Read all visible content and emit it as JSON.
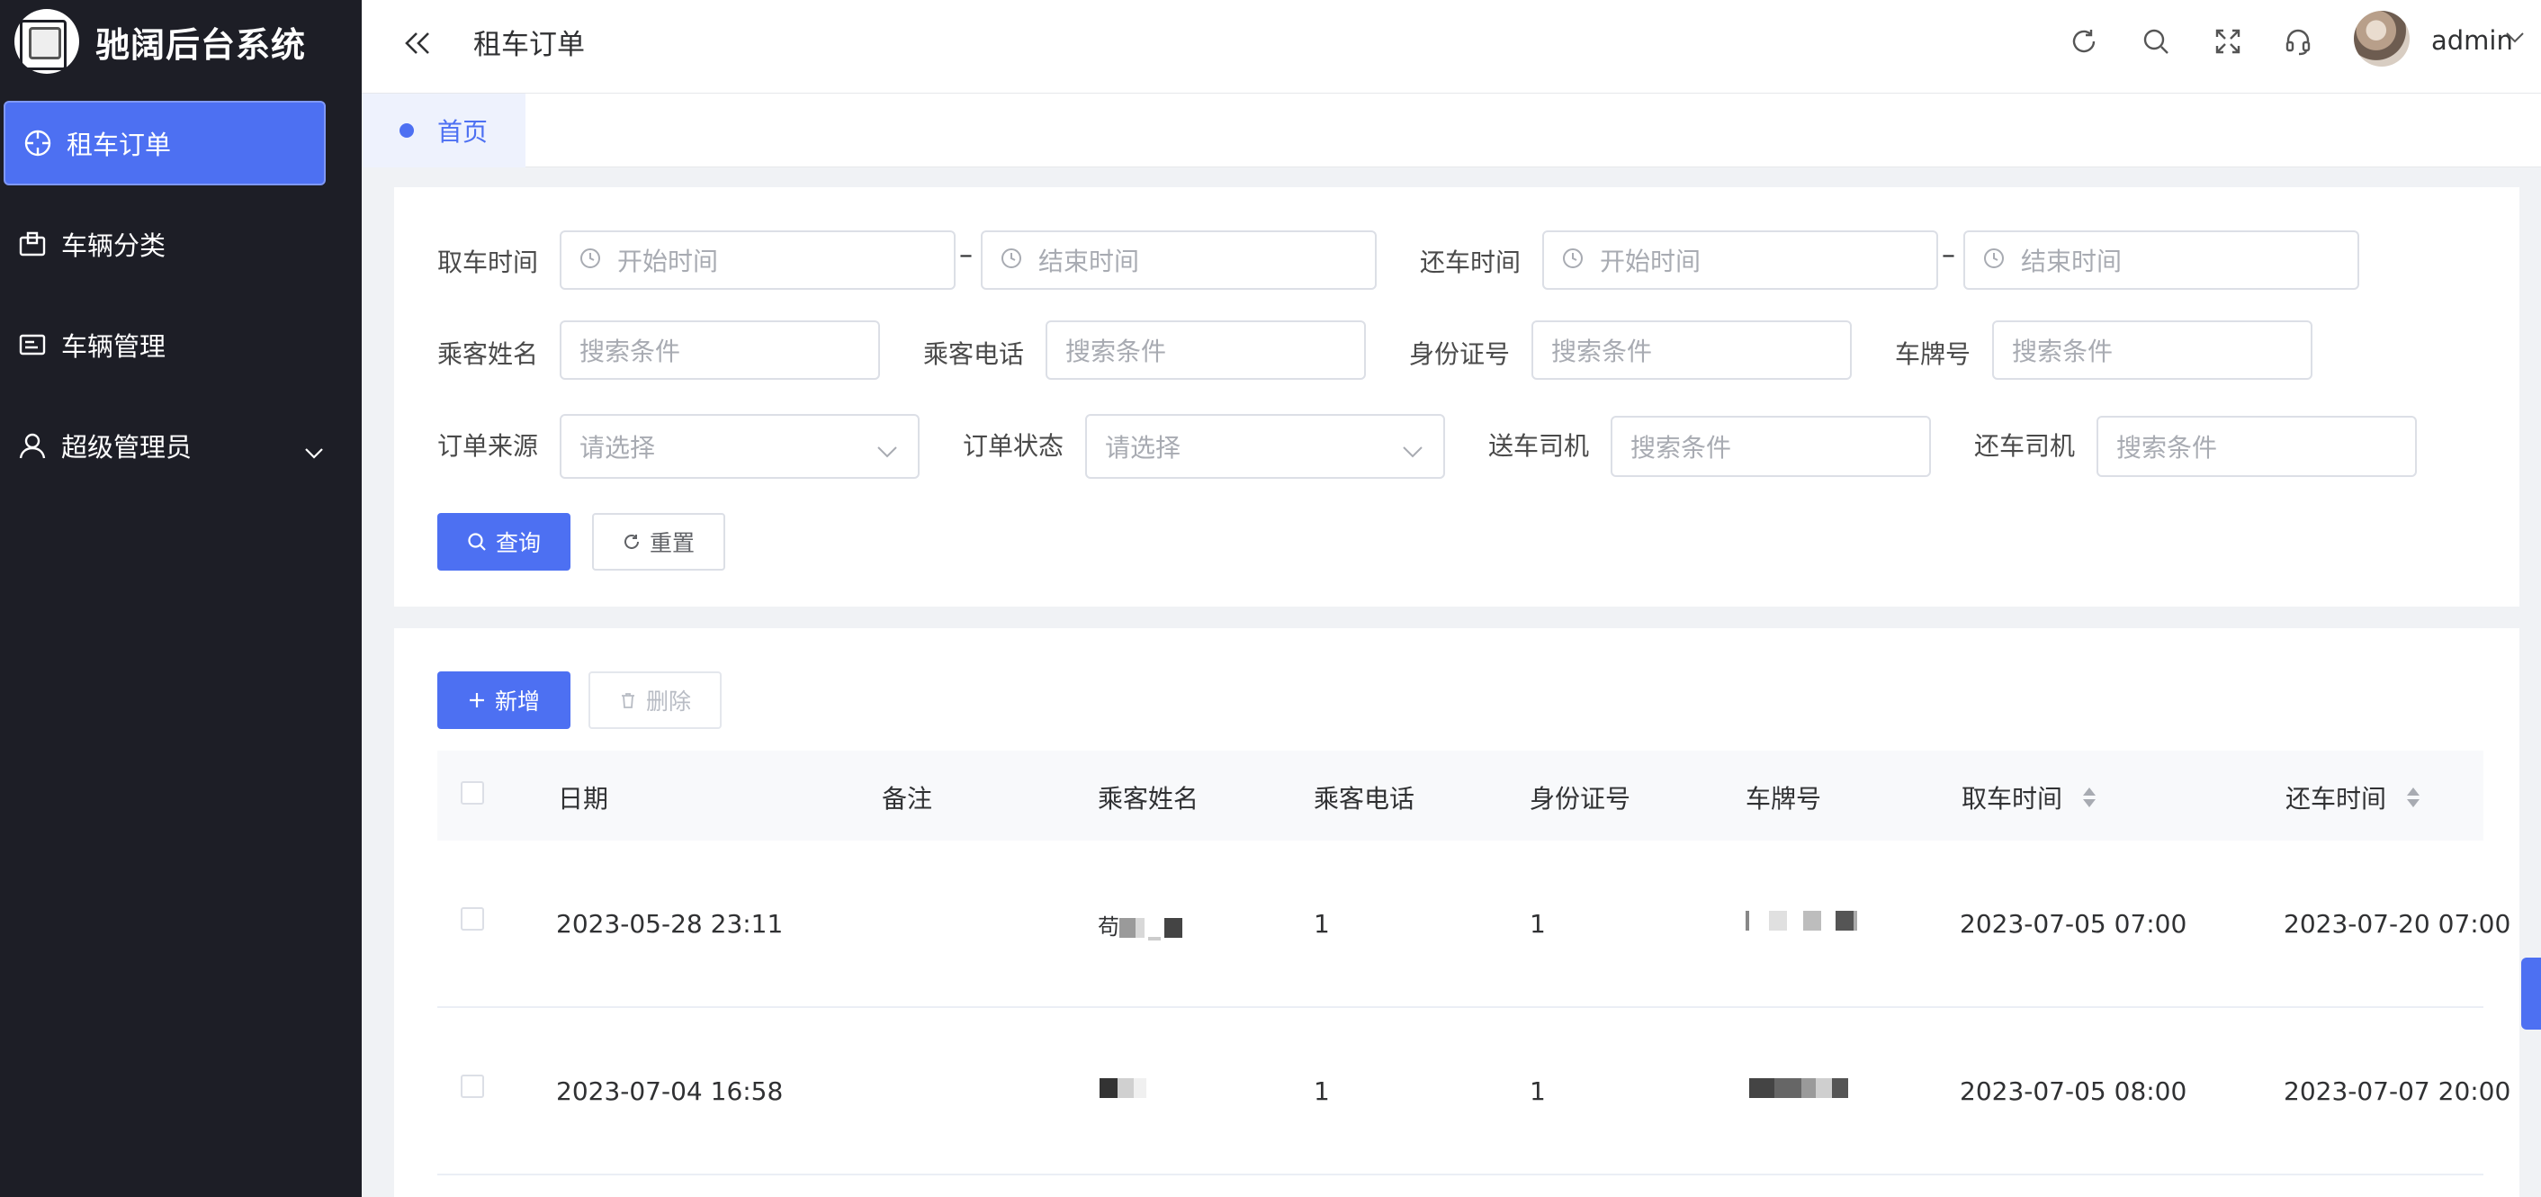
{
  "app": {
    "title": "驰阔后台系统"
  },
  "sidebar": {
    "items": [
      {
        "label": "租车订单",
        "icon": "compass-icon",
        "active": true
      },
      {
        "label": "车辆分类",
        "icon": "box-icon",
        "active": false
      },
      {
        "label": "车辆管理",
        "icon": "card-icon",
        "active": false
      },
      {
        "label": "超级管理员",
        "icon": "user-icon",
        "active": false,
        "expandable": true
      }
    ]
  },
  "header": {
    "page_title": "租车订单",
    "username": "admin",
    "icons": [
      "refresh-icon",
      "search-icon",
      "fullscreen-icon",
      "headset-icon"
    ]
  },
  "tabs": [
    {
      "label": "首页",
      "active": true
    }
  ],
  "search": {
    "pickup_time_label": "取车时间",
    "return_time_label": "还车时间",
    "start_placeholder": "开始时间",
    "end_placeholder": "结束时间",
    "range_separator": "–",
    "passenger_name_label": "乘客姓名",
    "passenger_phone_label": "乘客电话",
    "id_number_label": "身份证号",
    "plate_label": "车牌号",
    "order_source_label": "订单来源",
    "order_status_label": "订单状态",
    "delivery_driver_label": "送车司机",
    "return_driver_label": "还车司机",
    "search_placeholder": "搜索条件",
    "select_placeholder": "请选择",
    "query_button": "查询",
    "reset_button": "重置"
  },
  "toolbar": {
    "add_button": "新增",
    "delete_button": "删除"
  },
  "table": {
    "columns": [
      "日期",
      "备注",
      "乘客姓名",
      "乘客电话",
      "身份证号",
      "车牌号",
      "取车时间",
      "还车时间"
    ],
    "rows": [
      {
        "date": "2023-05-28 23:11",
        "remark": "",
        "name": "苟",
        "phone": "1",
        "id_number": "1",
        "plate": "",
        "pickup": "2023-07-05 07:00",
        "return": "2023-07-20 07:00"
      },
      {
        "date": "2023-07-04 16:58",
        "remark": "",
        "name": "",
        "phone": "1",
        "id_number": "1",
        "plate": "",
        "pickup": "2023-07-05 08:00",
        "return": "2023-07-07 20:00"
      }
    ]
  },
  "colors": {
    "primary": "#4d70f2",
    "sidebar_bg": "#1d1e26"
  }
}
